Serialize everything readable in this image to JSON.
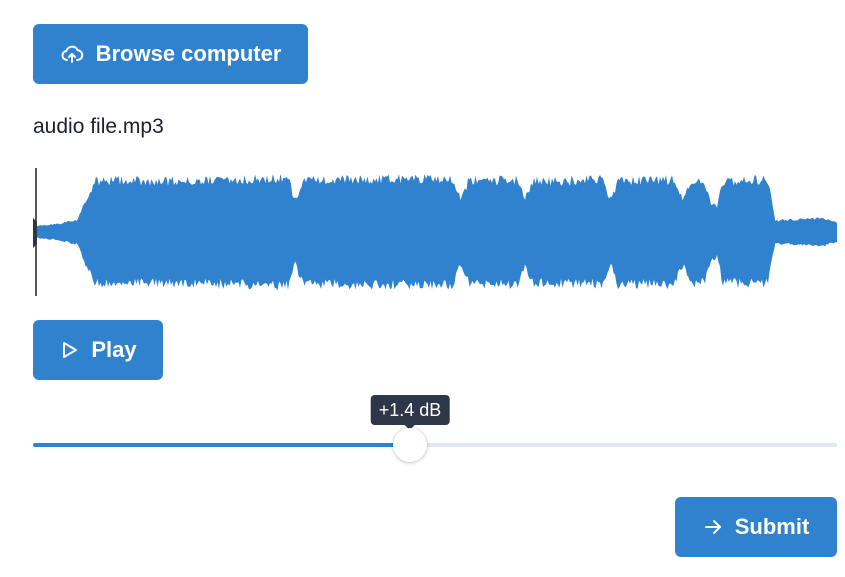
{
  "colors": {
    "accent": "#3182ce",
    "track": "#e2e8f0",
    "tooltip_bg": "#2d3748",
    "cursor": "#1a202c"
  },
  "upload": {
    "button_label": "Browse computer",
    "icon": "cloud-upload-icon"
  },
  "file": {
    "name": "audio file.mp3"
  },
  "player": {
    "play_label": "Play",
    "play_icon": "play-icon",
    "playhead_fraction": 0
  },
  "gain": {
    "value_label": "+1.4 dB",
    "position_fraction": 0.469
  },
  "submit": {
    "label": "Submit",
    "icon": "arrow-right-icon"
  }
}
